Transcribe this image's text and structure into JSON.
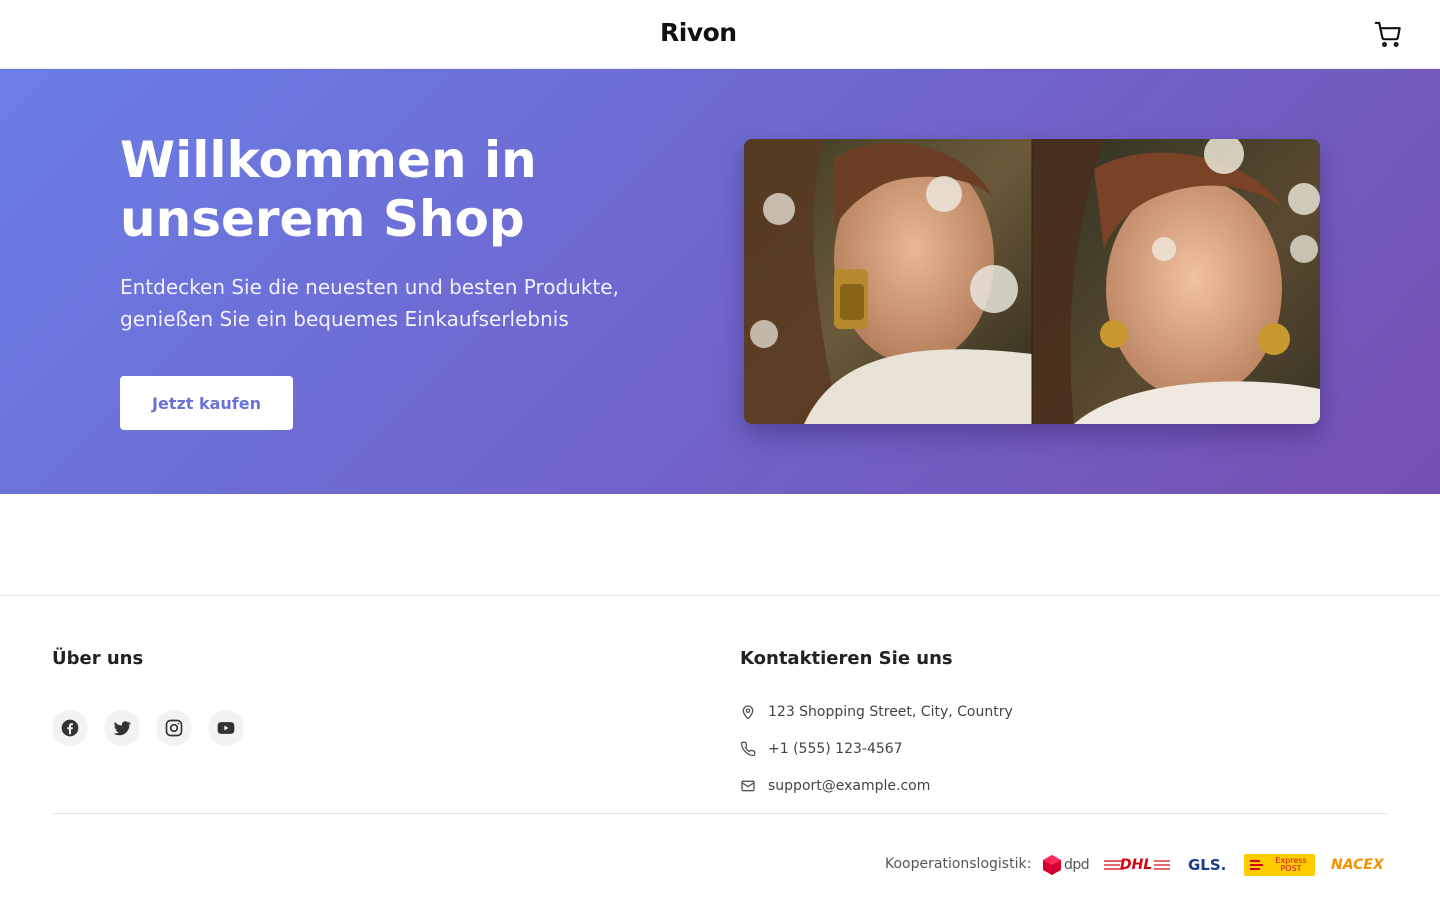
{
  "header": {
    "logo_text": "Rivon",
    "cart_icon": "shopping-cart-icon"
  },
  "hero": {
    "title": "Willkommen in unserem Shop",
    "subtitle": "Entdecken Sie die neuesten und besten Produkte, genießen Sie ein bequemes Einkaufserlebnis",
    "cta_label": "Jetzt kaufen",
    "image": "two-portrait-photos-of-women-among-flowers",
    "colors": {
      "gradient_start": "#6a7fe6",
      "gradient_end": "#7650b0",
      "cta_text": "#6a72d6"
    }
  },
  "footer": {
    "about": {
      "heading": "Über uns",
      "social": [
        "facebook-icon",
        "twitter-icon",
        "instagram-icon",
        "youtube-icon"
      ]
    },
    "contact": {
      "heading": "Kontaktieren Sie uns",
      "address": "123 Shopping Street, City, Country",
      "phone": "+1 (555) 123-4567",
      "email": "support@example.com",
      "icons": [
        "map-pin-icon",
        "phone-icon",
        "mail-icon"
      ]
    },
    "logistics": {
      "label": "Kooperationslogistik:",
      "partners": [
        "dpd",
        "DHL",
        "GLS.",
        "Express POST",
        "NACEX"
      ]
    }
  }
}
